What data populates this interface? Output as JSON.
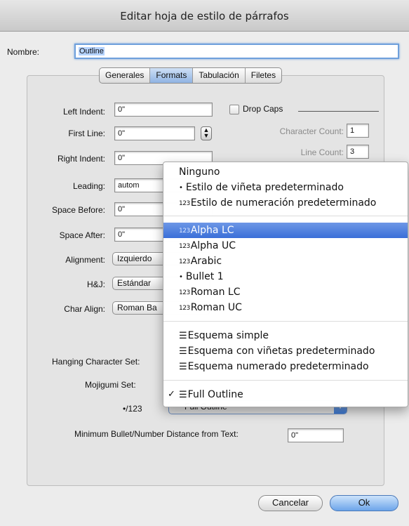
{
  "window": {
    "title": "Editar hoja de estilo de párrafos"
  },
  "name": {
    "label": "Nombre:",
    "value": "Outline"
  },
  "tabs": [
    {
      "label": "Generales",
      "active": false
    },
    {
      "label": "Formats",
      "active": true
    },
    {
      "label": "Tabulación",
      "active": false
    },
    {
      "label": "Filetes",
      "active": false
    }
  ],
  "formats": {
    "left_indent": {
      "label": "Left Indent:",
      "value": "0\""
    },
    "first_line": {
      "label": "First Line:",
      "value": "0\""
    },
    "right_indent": {
      "label": "Right Indent:",
      "value": "0\""
    },
    "leading": {
      "label": "Leading:",
      "value": "autom"
    },
    "space_before": {
      "label": "Space Before:",
      "value": "0\""
    },
    "space_after": {
      "label": "Space After:",
      "value": "0\""
    },
    "alignment": {
      "label": "Alignment:",
      "value": "Izquierdo"
    },
    "hj": {
      "label": "H&J:",
      "value": "Estándar"
    },
    "char_align": {
      "label": "Char Align:",
      "value": "Roman Ba"
    },
    "drop_caps": {
      "label": "Drop Caps",
      "checked": false
    },
    "character_count": {
      "label": "Character Count:",
      "value": "1"
    },
    "line_count": {
      "label": "Line Count:",
      "value": "3"
    },
    "hanging_char_set": {
      "label": "Hanging Character Set:"
    },
    "mojigumi_set": {
      "label": "Mojigumi Set:"
    },
    "bullet_num": {
      "label": "•/123",
      "value": "Full Outline"
    },
    "min_distance": {
      "label": "Minimum Bullet/Number Distance from Text:",
      "value": "0\""
    }
  },
  "menu": {
    "items": [
      {
        "label": "Ninguno",
        "glyph": ""
      },
      {
        "label": "Estilo de viñeta predeterminado",
        "glyph": "•"
      },
      {
        "label": "Estilo de numeración predeterminado",
        "glyph": "123"
      },
      {
        "label": "Alpha LC",
        "glyph": "123",
        "highlighted": true
      },
      {
        "label": "Alpha UC",
        "glyph": "123"
      },
      {
        "label": "Arabic",
        "glyph": "123"
      },
      {
        "label": "Bullet 1",
        "glyph": "•"
      },
      {
        "label": "Roman LC",
        "glyph": "123"
      },
      {
        "label": "Roman UC",
        "glyph": "123"
      },
      {
        "label": "Esquema simple",
        "glyph": "☰"
      },
      {
        "label": "Esquema con viñetas predeterminado",
        "glyph": "☰"
      },
      {
        "label": "Esquema numerado predeterminado",
        "glyph": "☰"
      },
      {
        "label": "Full Outline",
        "glyph": "☰",
        "checked": true
      }
    ],
    "check_mark": "✓"
  },
  "buttons": {
    "cancel": "Cancelar",
    "ok": "Ok"
  },
  "colors": {
    "highlight": "#3a6fd8",
    "default_button": "#6ca4ea"
  }
}
